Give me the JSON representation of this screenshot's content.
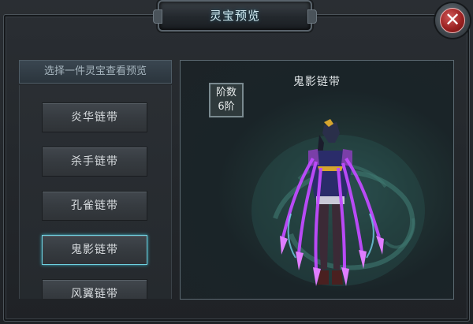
{
  "window": {
    "title": "灵宝预览",
    "close_symbol": "✕"
  },
  "list": {
    "header": "选择一件灵宝查看预览",
    "items": [
      {
        "label": "炎华链带"
      },
      {
        "label": "杀手链带"
      },
      {
        "label": "孔雀链带"
      },
      {
        "label": "鬼影链带",
        "selected": true
      },
      {
        "label": "风翼链带"
      }
    ]
  },
  "preview": {
    "name": "鬼影链带",
    "level_label": "阶数",
    "level_value": "6阶"
  },
  "colors": {
    "accent_cyan": "#6fd1e0",
    "close_red": "#9c2222",
    "item_glow_purple": "#c04bff"
  }
}
